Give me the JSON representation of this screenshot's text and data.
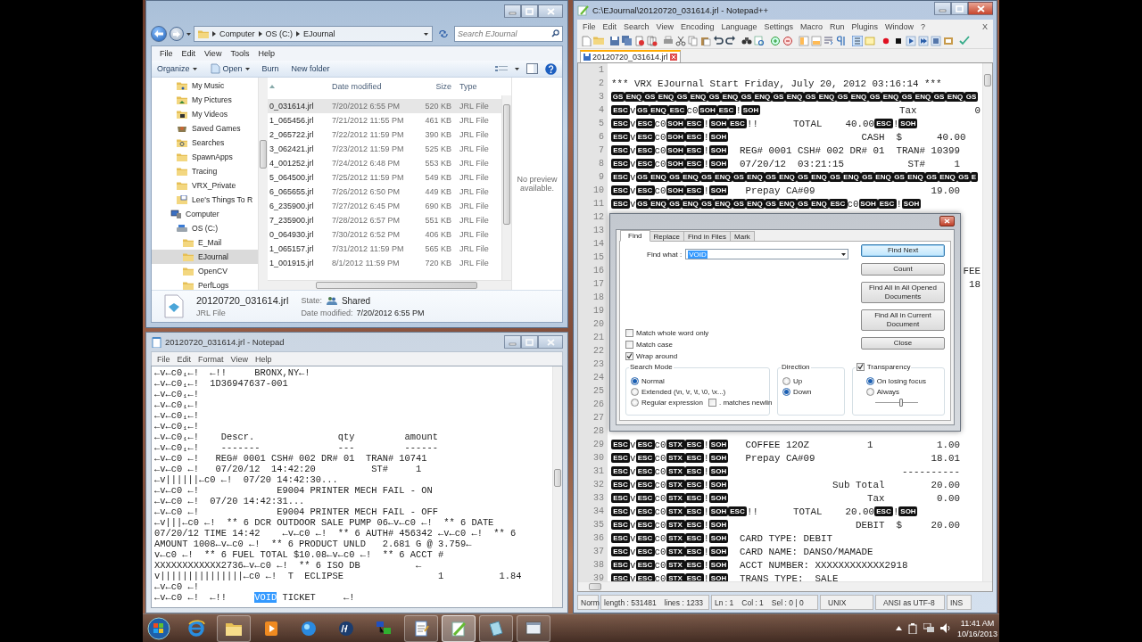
{
  "explorer": {
    "address": {
      "crumbs": [
        "Computer",
        "OS (C:)",
        "EJournal"
      ]
    },
    "search": {
      "placeholder": "Search EJournal"
    },
    "menu": [
      "File",
      "Edit",
      "View",
      "Tools",
      "Help"
    ],
    "toolbar": [
      {
        "label": "Organize",
        "kind": "menu"
      },
      {
        "label": "Open",
        "kind": "split"
      },
      {
        "label": "Burn",
        "kind": "plain"
      },
      {
        "label": "New folder",
        "kind": "plain"
      }
    ],
    "nav": [
      {
        "label": "My Music",
        "kind": "music",
        "selected": false
      },
      {
        "label": "My Pictures",
        "kind": "pictures",
        "selected": false
      },
      {
        "label": "My Videos",
        "kind": "videos",
        "selected": false
      },
      {
        "label": "Saved Games",
        "kind": "games",
        "selected": false
      },
      {
        "label": "Searches",
        "kind": "search",
        "selected": false
      },
      {
        "label": "SpawnApps",
        "kind": "folder",
        "selected": false
      },
      {
        "label": "Tracing",
        "kind": "folder",
        "selected": false
      },
      {
        "label": "VRX_Private",
        "kind": "folder",
        "selected": false
      },
      {
        "label": "Lee's Things To R",
        "kind": "note",
        "selected": false
      },
      {
        "label": "Computer",
        "kind": "computer",
        "selected": false,
        "children": [
          {
            "label": "OS (C:)",
            "kind": "drive",
            "selected": false,
            "children": [
              {
                "label": "E_Mail",
                "kind": "folder",
                "selected": false
              },
              {
                "label": "EJournal",
                "kind": "folder",
                "selected": true
              },
              {
                "label": "OpenCV",
                "kind": "folder",
                "selected": false
              },
              {
                "label": "PerfLogs",
                "kind": "folder",
                "selected": false
              }
            ]
          }
        ]
      }
    ],
    "files": {
      "columns": [
        "Date modified",
        "Size",
        "Type"
      ],
      "rows": [
        {
          "name": "0_031614.jrl",
          "date": "7/20/2012 6:55 PM",
          "size": "520 KB",
          "type": "JRL File",
          "selected": true
        },
        {
          "name": "1_065456.jrl",
          "date": "7/21/2012 11:55 PM",
          "size": "461 KB",
          "type": "JRL File",
          "selected": false
        },
        {
          "name": "2_065722.jrl",
          "date": "7/22/2012 11:59 PM",
          "size": "390 KB",
          "type": "JRL File",
          "selected": false
        },
        {
          "name": "3_062421.jrl",
          "date": "7/23/2012 11:59 PM",
          "size": "525 KB",
          "type": "JRL File",
          "selected": false
        },
        {
          "name": "4_001252.jrl",
          "date": "7/24/2012 6:48 PM",
          "size": "553 KB",
          "type": "JRL File",
          "selected": false
        },
        {
          "name": "5_064500.jrl",
          "date": "7/25/2012 11:59 PM",
          "size": "549 KB",
          "type": "JRL File",
          "selected": false
        },
        {
          "name": "6_065655.jrl",
          "date": "7/26/2012 6:50 PM",
          "size": "449 KB",
          "type": "JRL File",
          "selected": false
        },
        {
          "name": "6_235900.jrl",
          "date": "7/27/2012 6:45 PM",
          "size": "690 KB",
          "type": "JRL File",
          "selected": false
        },
        {
          "name": "7_235900.jrl",
          "date": "7/28/2012 6:57 PM",
          "size": "551 KB",
          "type": "JRL File",
          "selected": false
        },
        {
          "name": "0_064930.jrl",
          "date": "7/30/2012 6:52 PM",
          "size": "406 KB",
          "type": "JRL File",
          "selected": false
        },
        {
          "name": "1_065157.jrl",
          "date": "7/31/2012 11:59 PM",
          "size": "565 KB",
          "type": "JRL File",
          "selected": false
        },
        {
          "name": "1_001915.jrl",
          "date": "8/1/2012 11:59 PM",
          "size": "720 KB",
          "type": "JRL File",
          "selected": false
        }
      ]
    },
    "preview": "No preview available.",
    "details": {
      "name": "20120720_031614.jrl",
      "type": "JRL File",
      "state_label": "State:",
      "state": "Shared",
      "date_label": "Date modified:",
      "date": "7/20/2012 6:55 PM"
    }
  },
  "notepad": {
    "title": "20120720_031614.jrl - Notepad",
    "menu": [
      "File",
      "Edit",
      "Format",
      "View",
      "Help"
    ],
    "lines": [
      {
        "text": "←v←c0₁←!  ←!!     BRONX,NY←!"
      },
      {
        "text": "←v←c0₁←!  1D36947637-001"
      },
      {
        "text": "←v←c0₁←!"
      },
      {
        "text": "←v←c0₁←!"
      },
      {
        "text": "←v←c0₁←!"
      },
      {
        "text": "←v←c0₁←!"
      },
      {
        "text": "←v←c0₁←!    Descr.               qty         amount"
      },
      {
        "text": "←v←c0₁←!    -------              ---         ------"
      },
      {
        "text": "←v←c0 ←!   REG# 0001 CSH# 002 DR# 01  TRAN# 10741"
      },
      {
        "text": "←v←c0 ←!   07/20/12  14:42:20          ST#     1"
      },
      {
        "text": "←v||||||←c0 ←!  07/20 14:42:30..."
      },
      {
        "text": "←v←c0 ←!              E9004 PRINTER MECH FAIL - ON"
      },
      {
        "text": "←v←c0 ←!  07/20 14:42:31..."
      },
      {
        "text": "←v←c0 ←!              E9004 PRINTER MECH FAIL - OFF"
      },
      {
        "text": "←v|||←c0 ←!  ** 6 DCR OUTDOOR SALE PUMP 06←v←c0 ←!  ** 6 DATE"
      },
      {
        "text": "07/20/12 TIME 14:42    ←v←c0 ←!  ** 6 AUTH# 456342 ←v←c0 ←!  ** 6"
      },
      {
        "text": "AMOUNT 1008←v←c0 ←!  ** 6 PRODUCT UNLD   2.681 G @ 3.759←"
      },
      {
        "text": "v←c0 ←!  ** 6 FUEL TOTAL $10.08←v←c0 ←!  ** 6 ACCT #"
      },
      {
        "text": "XXXXXXXXXXXX2736←v←c0 ←!  ** 6 ISO DB          ←"
      },
      {
        "text": "v|||||||||||||||←c0 ←!  T  ECLIPSE                 1          1.84"
      },
      {
        "text": "←v←c0 ←!"
      },
      {
        "text": "←v←c0 ←!  ←!!     ",
        "selection": "VOID",
        "after": " TICKET     ←!"
      }
    ]
  },
  "npp": {
    "title": "C:\\EJournal\\20120720_031614.jrl - Notepad++",
    "menu": [
      "File",
      "Edit",
      "Search",
      "View",
      "Encoding",
      "Language",
      "Settings",
      "Macro",
      "Run",
      "Plugins",
      "Window",
      "?"
    ],
    "close_doc": "X",
    "tab": {
      "label": "20120720_031614.jrl",
      "selected": true
    },
    "lines": [
      {
        "number": "1"
      },
      {
        "number": "2",
        "parts": [
          {
            "kind": "text",
            "text": "*** VRX EJournal Start Friday, July 20, 2012 03:16:14 ***"
          }
        ]
      },
      {
        "number": "3",
        "parts": [
          {
            "kind": "ctrl",
            "text": "GS"
          },
          {
            "kind": "ctrl",
            "text": "ENQ"
          },
          {
            "kind": "ctrl",
            "text": "GS"
          },
          {
            "kind": "ctrl",
            "text": "ENQ"
          },
          {
            "kind": "ctrl",
            "text": "GS"
          },
          {
            "kind": "ctrl",
            "text": "ENQ"
          },
          {
            "kind": "ctrl",
            "text": "GS"
          },
          {
            "kind": "ctrl",
            "text": "ENQ"
          },
          {
            "kind": "ctrl",
            "text": "GS"
          },
          {
            "kind": "ctrl",
            "text": "ENQ"
          },
          {
            "kind": "ctrl",
            "text": "GS"
          },
          {
            "kind": "ctrl",
            "text": "ENQ"
          },
          {
            "kind": "ctrl",
            "text": "GS"
          },
          {
            "kind": "ctrl",
            "text": "ENQ"
          },
          {
            "kind": "ctrl",
            "text": "GS"
          },
          {
            "kind": "ctrl",
            "text": "ENQ"
          },
          {
            "kind": "ctrl",
            "text": "GS"
          },
          {
            "kind": "ctrl",
            "text": "ENQ"
          },
          {
            "kind": "ctrl",
            "text": "GS"
          },
          {
            "kind": "ctrl",
            "text": "ENQ"
          },
          {
            "kind": "ctrl",
            "text": "GS"
          },
          {
            "kind": "ctrl",
            "text": "ENQ"
          },
          {
            "kind": "ctrl",
            "text": "GS"
          }
        ]
      },
      {
        "number": "4",
        "parts": [
          {
            "kind": "ctrl",
            "text": "ESC"
          },
          {
            "kind": "text",
            "text": "v"
          },
          {
            "kind": "ctrl",
            "text": "GS"
          },
          {
            "kind": "ctrl",
            "text": "ENQ"
          },
          {
            "kind": "ctrl",
            "text": "ESC"
          },
          {
            "kind": "text",
            "text": "c0"
          },
          {
            "kind": "ctrl",
            "text": "SOH"
          },
          {
            "kind": "ctrl",
            "text": "ESC"
          },
          {
            "kind": "text",
            "text": "!"
          },
          {
            "kind": "ctrl",
            "text": "SOH"
          },
          {
            "kind": "text",
            "text": "                        Tax          0"
          }
        ]
      },
      {
        "number": "5",
        "parts": [
          {
            "kind": "ctrl",
            "text": "ESC"
          },
          {
            "kind": "text",
            "text": "v"
          },
          {
            "kind": "ctrl",
            "text": "ESC"
          },
          {
            "kind": "text",
            "text": "c0"
          },
          {
            "kind": "ctrl",
            "text": "SOH"
          },
          {
            "kind": "ctrl",
            "text": "ESC"
          },
          {
            "kind": "text",
            "text": "!"
          },
          {
            "kind": "ctrl",
            "text": "SOH"
          },
          {
            "kind": "ctrl",
            "text": "ESC"
          },
          {
            "kind": "text",
            "text": "!!      TOTAL    40.00"
          },
          {
            "kind": "ctrl",
            "text": "ESC"
          },
          {
            "kind": "text",
            "text": "!"
          },
          {
            "kind": "ctrl",
            "text": "SOH"
          }
        ]
      },
      {
        "number": "6",
        "parts": [
          {
            "kind": "ctrl",
            "text": "ESC"
          },
          {
            "kind": "text",
            "text": "v"
          },
          {
            "kind": "ctrl",
            "text": "ESC"
          },
          {
            "kind": "text",
            "text": "c0"
          },
          {
            "kind": "ctrl",
            "text": "SOH"
          },
          {
            "kind": "ctrl",
            "text": "ESC"
          },
          {
            "kind": "text",
            "text": "!"
          },
          {
            "kind": "ctrl",
            "text": "SOH"
          },
          {
            "kind": "text",
            "text": "                       CASH  $      40.00"
          }
        ]
      },
      {
        "number": "7",
        "parts": [
          {
            "kind": "ctrl",
            "text": "ESC"
          },
          {
            "kind": "text",
            "text": "v"
          },
          {
            "kind": "ctrl",
            "text": "ESC"
          },
          {
            "kind": "text",
            "text": "c0"
          },
          {
            "kind": "ctrl",
            "text": "SOH"
          },
          {
            "kind": "ctrl",
            "text": "ESC"
          },
          {
            "kind": "text",
            "text": "!"
          },
          {
            "kind": "ctrl",
            "text": "SOH"
          },
          {
            "kind": "text",
            "text": "  REG# 0001 CSH# 002 DR# 01  TRAN# 10399"
          }
        ]
      },
      {
        "number": "8",
        "parts": [
          {
            "kind": "ctrl",
            "text": "ESC"
          },
          {
            "kind": "text",
            "text": "v"
          },
          {
            "kind": "ctrl",
            "text": "ESC"
          },
          {
            "kind": "text",
            "text": "c0"
          },
          {
            "kind": "ctrl",
            "text": "SOH"
          },
          {
            "kind": "ctrl",
            "text": "ESC"
          },
          {
            "kind": "text",
            "text": "!"
          },
          {
            "kind": "ctrl",
            "text": "SOH"
          },
          {
            "kind": "text",
            "text": "  07/20/12  03:21:15           ST#     1"
          }
        ]
      },
      {
        "number": "9",
        "parts": [
          {
            "kind": "ctrl",
            "text": "ESC"
          },
          {
            "kind": "text",
            "text": "v"
          },
          {
            "kind": "ctrl",
            "text": "GS"
          },
          {
            "kind": "ctrl",
            "text": "ENQ"
          },
          {
            "kind": "ctrl",
            "text": "GS"
          },
          {
            "kind": "ctrl",
            "text": "ENQ"
          },
          {
            "kind": "ctrl",
            "text": "GS"
          },
          {
            "kind": "ctrl",
            "text": "ENQ"
          },
          {
            "kind": "ctrl",
            "text": "GS"
          },
          {
            "kind": "ctrl",
            "text": "ENQ"
          },
          {
            "kind": "ctrl",
            "text": "GS"
          },
          {
            "kind": "ctrl",
            "text": "ENQ"
          },
          {
            "kind": "ctrl",
            "text": "GS"
          },
          {
            "kind": "ctrl",
            "text": "ENQ"
          },
          {
            "kind": "ctrl",
            "text": "GS"
          },
          {
            "kind": "ctrl",
            "text": "ENQ"
          },
          {
            "kind": "ctrl",
            "text": "GS"
          },
          {
            "kind": "ctrl",
            "text": "ENQ"
          },
          {
            "kind": "ctrl",
            "text": "GS"
          },
          {
            "kind": "ctrl",
            "text": "ENQ"
          },
          {
            "kind": "ctrl",
            "text": "GS"
          },
          {
            "kind": "ctrl",
            "text": "ENQ"
          },
          {
            "kind": "ctrl",
            "text": "GS"
          },
          {
            "kind": "ctrl",
            "text": "E"
          }
        ]
      },
      {
        "number": "10",
        "parts": [
          {
            "kind": "ctrl",
            "text": "ESC"
          },
          {
            "kind": "text",
            "text": "v"
          },
          {
            "kind": "ctrl",
            "text": "ESC"
          },
          {
            "kind": "text",
            "text": "c0"
          },
          {
            "kind": "ctrl",
            "text": "SOH"
          },
          {
            "kind": "ctrl",
            "text": "ESC"
          },
          {
            "kind": "text",
            "text": "!"
          },
          {
            "kind": "ctrl",
            "text": "SOH"
          },
          {
            "kind": "text",
            "text": "   Prepay CA#09                    19.00"
          }
        ]
      },
      {
        "number": "11",
        "parts": [
          {
            "kind": "ctrl",
            "text": "ESC"
          },
          {
            "kind": "text",
            "text": "v"
          },
          {
            "kind": "ctrl",
            "text": "GS"
          },
          {
            "kind": "ctrl",
            "text": "ENQ"
          },
          {
            "kind": "ctrl",
            "text": "GS"
          },
          {
            "kind": "ctrl",
            "text": "ENQ"
          },
          {
            "kind": "ctrl",
            "text": "GS"
          },
          {
            "kind": "ctrl",
            "text": "ENQ"
          },
          {
            "kind": "ctrl",
            "text": "GS"
          },
          {
            "kind": "ctrl",
            "text": "ENQ"
          },
          {
            "kind": "ctrl",
            "text": "GS"
          },
          {
            "kind": "ctrl",
            "text": "ENQ"
          },
          {
            "kind": "ctrl",
            "text": "GS"
          },
          {
            "kind": "ctrl",
            "text": "ENQ"
          },
          {
            "kind": "ctrl",
            "text": "ESC"
          },
          {
            "kind": "text",
            "text": "c0"
          },
          {
            "kind": "ctrl",
            "text": "SOH"
          },
          {
            "kind": "ctrl",
            "text": "ESC"
          },
          {
            "kind": "text",
            "text": "!"
          },
          {
            "kind": "ctrl",
            "text": "SOH"
          }
        ]
      },
      {
        "number": "12"
      },
      {
        "number": "13"
      },
      {
        "number": "14"
      },
      {
        "number": "15"
      },
      {
        "number": "16",
        "parts": [
          {
            "kind": "tail",
            "text": "FEE"
          }
        ]
      },
      {
        "number": "17",
        "parts": [
          {
            "kind": "tail",
            "text": "18"
          }
        ]
      },
      {
        "number": "18"
      },
      {
        "number": "19"
      },
      {
        "number": "20"
      },
      {
        "number": "21"
      },
      {
        "number": "22"
      },
      {
        "number": "23"
      },
      {
        "number": "24"
      },
      {
        "number": "25"
      },
      {
        "number": "26"
      },
      {
        "number": "27"
      },
      {
        "number": "28"
      },
      {
        "number": "29",
        "parts": [
          {
            "kind": "ctrl",
            "text": "ESC"
          },
          {
            "kind": "text",
            "text": "v"
          },
          {
            "kind": "ctrl",
            "text": "ESC"
          },
          {
            "kind": "text",
            "text": "c0"
          },
          {
            "kind": "ctrl",
            "text": "STX"
          },
          {
            "kind": "ctrl",
            "text": "ESC"
          },
          {
            "kind": "text",
            "text": "!"
          },
          {
            "kind": "ctrl",
            "text": "SOH"
          },
          {
            "kind": "text",
            "text": "   COFFEE 12OZ          1           1.00"
          }
        ]
      },
      {
        "number": "30",
        "parts": [
          {
            "kind": "ctrl",
            "text": "ESC"
          },
          {
            "kind": "text",
            "text": "v"
          },
          {
            "kind": "ctrl",
            "text": "ESC"
          },
          {
            "kind": "text",
            "text": "c0"
          },
          {
            "kind": "ctrl",
            "text": "STX"
          },
          {
            "kind": "ctrl",
            "text": "ESC"
          },
          {
            "kind": "text",
            "text": "!"
          },
          {
            "kind": "ctrl",
            "text": "SOH"
          },
          {
            "kind": "text",
            "text": "   Prepay CA#09                    18.01"
          }
        ]
      },
      {
        "number": "31",
        "parts": [
          {
            "kind": "ctrl",
            "text": "ESC"
          },
          {
            "kind": "text",
            "text": "v"
          },
          {
            "kind": "ctrl",
            "text": "ESC"
          },
          {
            "kind": "text",
            "text": "c0"
          },
          {
            "kind": "ctrl",
            "text": "STX"
          },
          {
            "kind": "ctrl",
            "text": "ESC"
          },
          {
            "kind": "text",
            "text": "!"
          },
          {
            "kind": "ctrl",
            "text": "SOH"
          },
          {
            "kind": "text",
            "text": "                              ----------"
          }
        ]
      },
      {
        "number": "32",
        "parts": [
          {
            "kind": "ctrl",
            "text": "ESC"
          },
          {
            "kind": "text",
            "text": "v"
          },
          {
            "kind": "ctrl",
            "text": "ESC"
          },
          {
            "kind": "text",
            "text": "c0"
          },
          {
            "kind": "ctrl",
            "text": "STX"
          },
          {
            "kind": "ctrl",
            "text": "ESC"
          },
          {
            "kind": "text",
            "text": "!"
          },
          {
            "kind": "ctrl",
            "text": "SOH"
          },
          {
            "kind": "text",
            "text": "                  Sub Total        20.00"
          }
        ]
      },
      {
        "number": "33",
        "parts": [
          {
            "kind": "ctrl",
            "text": "ESC"
          },
          {
            "kind": "text",
            "text": "v"
          },
          {
            "kind": "ctrl",
            "text": "ESC"
          },
          {
            "kind": "text",
            "text": "c0"
          },
          {
            "kind": "ctrl",
            "text": "STX"
          },
          {
            "kind": "ctrl",
            "text": "ESC"
          },
          {
            "kind": "text",
            "text": "!"
          },
          {
            "kind": "ctrl",
            "text": "SOH"
          },
          {
            "kind": "text",
            "text": "                        Tax         0.00"
          }
        ]
      },
      {
        "number": "34",
        "parts": [
          {
            "kind": "ctrl",
            "text": "ESC"
          },
          {
            "kind": "text",
            "text": "v"
          },
          {
            "kind": "ctrl",
            "text": "ESC"
          },
          {
            "kind": "text",
            "text": "c0"
          },
          {
            "kind": "ctrl",
            "text": "STX"
          },
          {
            "kind": "ctrl",
            "text": "ESC"
          },
          {
            "kind": "text",
            "text": "!"
          },
          {
            "kind": "ctrl",
            "text": "SOH"
          },
          {
            "kind": "ctrl",
            "text": "ESC"
          },
          {
            "kind": "text",
            "text": "!!      TOTAL    20.00"
          },
          {
            "kind": "ctrl",
            "text": "ESC"
          },
          {
            "kind": "text",
            "text": "!"
          },
          {
            "kind": "ctrl",
            "text": "SOH"
          }
        ]
      },
      {
        "number": "35",
        "parts": [
          {
            "kind": "ctrl",
            "text": "ESC"
          },
          {
            "kind": "text",
            "text": "v"
          },
          {
            "kind": "ctrl",
            "text": "ESC"
          },
          {
            "kind": "text",
            "text": "c0"
          },
          {
            "kind": "ctrl",
            "text": "STX"
          },
          {
            "kind": "ctrl",
            "text": "ESC"
          },
          {
            "kind": "text",
            "text": "!"
          },
          {
            "kind": "ctrl",
            "text": "SOH"
          },
          {
            "kind": "text",
            "text": "                      DEBIT  $     20.00"
          }
        ]
      },
      {
        "number": "36",
        "parts": [
          {
            "kind": "ctrl",
            "text": "ESC"
          },
          {
            "kind": "text",
            "text": "v"
          },
          {
            "kind": "ctrl",
            "text": "ESC"
          },
          {
            "kind": "text",
            "text": "c0"
          },
          {
            "kind": "ctrl",
            "text": "STX"
          },
          {
            "kind": "ctrl",
            "text": "ESC"
          },
          {
            "kind": "text",
            "text": "!"
          },
          {
            "kind": "ctrl",
            "text": "SOH"
          },
          {
            "kind": "text",
            "text": "  CARD TYPE: DEBIT"
          }
        ]
      },
      {
        "number": "37",
        "parts": [
          {
            "kind": "ctrl",
            "text": "ESC"
          },
          {
            "kind": "text",
            "text": "v"
          },
          {
            "kind": "ctrl",
            "text": "ESC"
          },
          {
            "kind": "text",
            "text": "c0"
          },
          {
            "kind": "ctrl",
            "text": "STX"
          },
          {
            "kind": "ctrl",
            "text": "ESC"
          },
          {
            "kind": "text",
            "text": "!"
          },
          {
            "kind": "ctrl",
            "text": "SOH"
          },
          {
            "kind": "text",
            "text": "  CARD NAME: DANSO/MAMADE"
          }
        ]
      },
      {
        "number": "38",
        "parts": [
          {
            "kind": "ctrl",
            "text": "ESC"
          },
          {
            "kind": "text",
            "text": "v"
          },
          {
            "kind": "ctrl",
            "text": "ESC"
          },
          {
            "kind": "text",
            "text": "c0"
          },
          {
            "kind": "ctrl",
            "text": "STX"
          },
          {
            "kind": "ctrl",
            "text": "ESC"
          },
          {
            "kind": "text",
            "text": "!"
          },
          {
            "kind": "ctrl",
            "text": "SOH"
          },
          {
            "kind": "text",
            "text": "  ACCT NUMBER: XXXXXXXXXXXX2918"
          }
        ]
      },
      {
        "number": "39",
        "parts": [
          {
            "kind": "ctrl",
            "text": "ESC"
          },
          {
            "kind": "text",
            "text": "v"
          },
          {
            "kind": "ctrl",
            "text": "ESC"
          },
          {
            "kind": "text",
            "text": "c0"
          },
          {
            "kind": "ctrl",
            "text": "STX"
          },
          {
            "kind": "ctrl",
            "text": "ESC"
          },
          {
            "kind": "text",
            "text": "!"
          },
          {
            "kind": "ctrl",
            "text": "SOH"
          },
          {
            "kind": "text",
            "text": "  TRANS TYPE:  SALE"
          }
        ]
      }
    ],
    "status": [
      "Norm",
      "length : 531481",
      "lines : 1233",
      "Ln : 1",
      "Col : 1",
      "Sel : 0 | 0",
      "UNIX",
      "ANSI as UTF-8",
      "INS"
    ]
  },
  "find": {
    "tabs": [
      {
        "label": "Find",
        "selected": true
      },
      {
        "label": "Replace",
        "selected": false
      },
      {
        "label": "Find in Files",
        "selected": false
      },
      {
        "label": "Mark",
        "selected": false
      }
    ],
    "find_what": {
      "label": "Find what :",
      "value": "VOID"
    },
    "buttons": [
      {
        "label": "Find Next",
        "default": true
      },
      {
        "label": "Count",
        "default": false
      },
      {
        "label": "Find All in All Opened Documents",
        "default": false
      },
      {
        "label": "Find All in Current Document",
        "default": false
      },
      {
        "label": "Close",
        "default": false
      }
    ],
    "options": [
      {
        "label": "Match whole word only",
        "checked": false
      },
      {
        "label": "Match case",
        "checked": false
      },
      {
        "label": "Wrap around",
        "checked": true
      }
    ],
    "search_mode": {
      "title": "Search Mode",
      "options": [
        {
          "label": "Normal",
          "selected": true
        },
        {
          "label": "Extended (\\n, \\r, \\t, \\0, \\x...)",
          "selected": false
        },
        {
          "label": "Regular expression",
          "selected": false
        }
      ],
      "dot_newline": {
        "label": ". matches newlin",
        "checked": false
      }
    },
    "direction": {
      "title": "Direction",
      "options": [
        {
          "label": "Up",
          "selected": false
        },
        {
          "label": "Down",
          "selected": true
        }
      ]
    },
    "transparency": {
      "label": "Transparency",
      "checked": true,
      "options": [
        {
          "label": "On losing focus",
          "selected": true
        },
        {
          "label": "Always",
          "selected": false
        }
      ],
      "level": 0.6
    }
  },
  "taskbar": {
    "apps": [
      {
        "kind": "browser",
        "running": false,
        "active": false
      },
      {
        "kind": "folder",
        "running": true,
        "active": false
      },
      {
        "kind": "media",
        "running": false,
        "active": false
      },
      {
        "kind": "globe",
        "running": false,
        "active": false
      },
      {
        "kind": "hp",
        "running": false,
        "active": false
      },
      {
        "kind": "network",
        "running": false,
        "active": false
      },
      {
        "kind": "notepad",
        "running": true,
        "active": false
      },
      {
        "kind": "notepadpp",
        "running": true,
        "active": true
      },
      {
        "kind": "tablet",
        "running": true,
        "active": false
      },
      {
        "kind": "window",
        "running": true,
        "active": false
      }
    ],
    "clock": {
      "time": "11:41 AM",
      "date": "10/16/2013"
    }
  }
}
